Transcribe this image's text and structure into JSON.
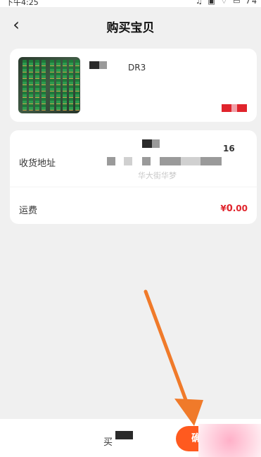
{
  "statusbar": {
    "time": "下午4:25",
    "icons": "♫ ▣ ⌔ ▭ 74"
  },
  "navbar": {
    "back_icon": "‹",
    "title": "购买宝贝"
  },
  "product": {
    "name": "DR3",
    "image": "memory-sticks-photo"
  },
  "address": {
    "label": "收货地址",
    "number": "16",
    "fragment": "华大街华梦"
  },
  "shipping": {
    "label": "运费",
    "currency": "¥",
    "integer": "0",
    "decimal": ".00"
  },
  "bottom": {
    "buy_label": "买",
    "confirm_label": "确"
  },
  "colors": {
    "accent": "#ff5a1f",
    "price_red": "#e0242c",
    "annotation_arrow": "#f07a2a"
  }
}
